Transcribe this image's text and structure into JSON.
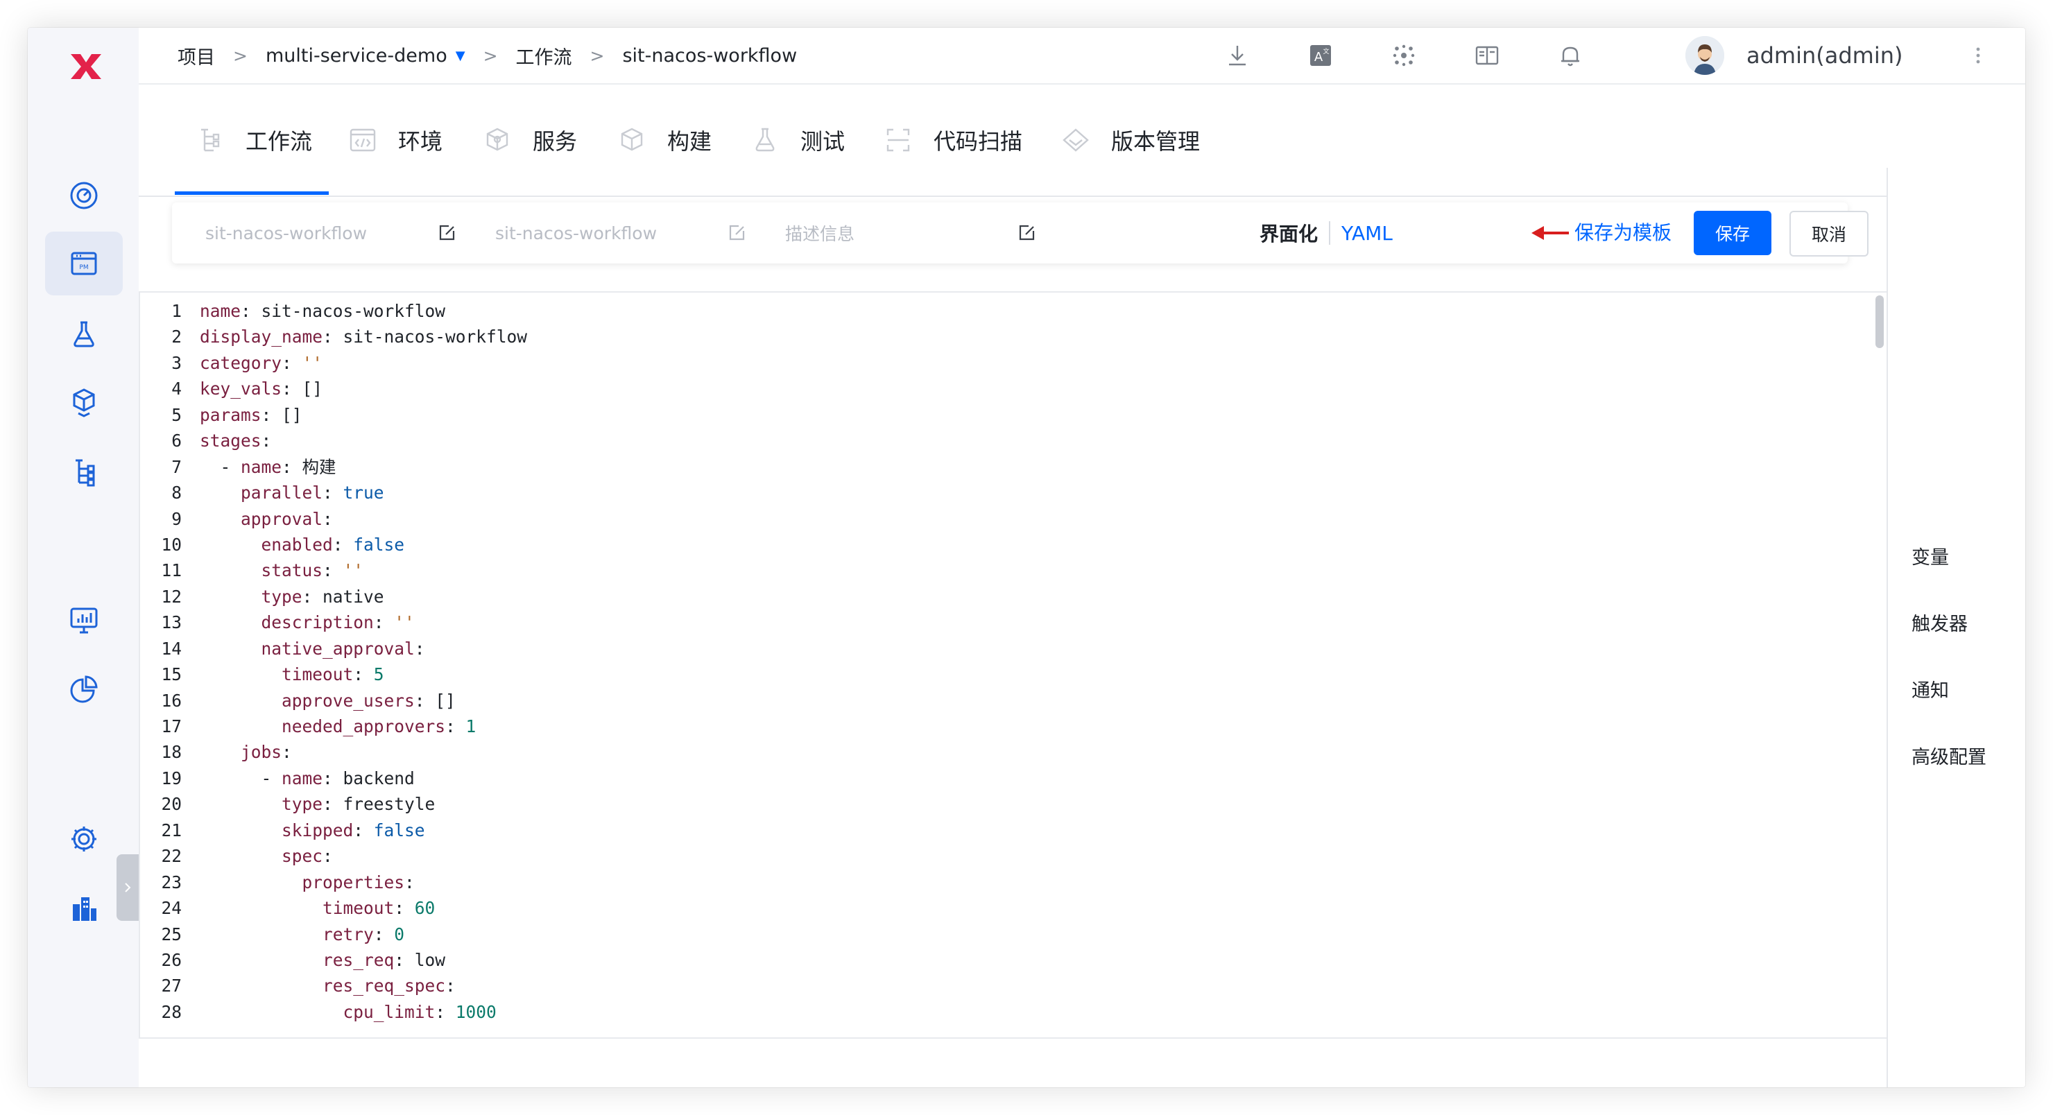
{
  "breadcrumb": {
    "project": "项目",
    "project_name": "multi-service-demo",
    "section": "工作流",
    "workflow": "sit-nacos-workflow",
    "separator": ">"
  },
  "user": {
    "name": "admin(admin)"
  },
  "top_icons": [
    "download-icon",
    "translate-icon",
    "plugin-icon",
    "docs-icon",
    "bell-icon"
  ],
  "tabs": [
    {
      "label": "工作流",
      "icon": "workflow-icon",
      "active": true
    },
    {
      "label": "环境",
      "icon": "environment-icon"
    },
    {
      "label": "服务",
      "icon": "service-icon"
    },
    {
      "label": "构建",
      "icon": "build-icon"
    },
    {
      "label": "测试",
      "icon": "test-icon"
    },
    {
      "label": "代码扫描",
      "icon": "code-scan-icon"
    },
    {
      "label": "版本管理",
      "icon": "version-icon"
    }
  ],
  "form": {
    "name_placeholder": "sit-nacos-workflow",
    "display_placeholder": "sit-nacos-workflow",
    "desc_placeholder": "描述信息",
    "mode_ui": "界面化",
    "mode_yaml": "YAML",
    "save_template": "保存为模板",
    "save": "保存",
    "cancel": "取消"
  },
  "right_panel": [
    "变量",
    "触发器",
    "通知",
    "高级配置"
  ],
  "colors": {
    "accent": "#0066ff",
    "brand": "#e3224a",
    "annotation_arrow": "#d81e1e"
  },
  "code": [
    {
      "n": "1",
      "i": "",
      "k": "name",
      "v": "sit-nacos-workflow",
      "t": "v"
    },
    {
      "n": "2",
      "i": "",
      "k": "display_name",
      "v": "sit-nacos-workflow",
      "t": "v"
    },
    {
      "n": "3",
      "i": "",
      "k": "category",
      "v": "''",
      "t": "str"
    },
    {
      "n": "4",
      "i": "",
      "k": "key_vals",
      "v": "[]",
      "t": "v"
    },
    {
      "n": "5",
      "i": "",
      "k": "params",
      "v": "[]",
      "t": "v"
    },
    {
      "n": "6",
      "i": "",
      "k": "stages",
      "v": "",
      "t": "v"
    },
    {
      "n": "7",
      "i": "  - ",
      "k": "name",
      "v": "构建",
      "t": "v"
    },
    {
      "n": "8",
      "i": "    ",
      "k": "parallel",
      "v": "true",
      "t": "bool"
    },
    {
      "n": "9",
      "i": "    ",
      "k": "approval",
      "v": "",
      "t": "v"
    },
    {
      "n": "10",
      "i": "      ",
      "k": "enabled",
      "v": "false",
      "t": "bool"
    },
    {
      "n": "11",
      "i": "      ",
      "k": "status",
      "v": "''",
      "t": "str"
    },
    {
      "n": "12",
      "i": "      ",
      "k": "type",
      "v": "native",
      "t": "v"
    },
    {
      "n": "13",
      "i": "      ",
      "k": "description",
      "v": "''",
      "t": "str"
    },
    {
      "n": "14",
      "i": "      ",
      "k": "native_approval",
      "v": "",
      "t": "v"
    },
    {
      "n": "15",
      "i": "        ",
      "k": "timeout",
      "v": "5",
      "t": "num"
    },
    {
      "n": "16",
      "i": "        ",
      "k": "approve_users",
      "v": "[]",
      "t": "v"
    },
    {
      "n": "17",
      "i": "        ",
      "k": "needed_approvers",
      "v": "1",
      "t": "num"
    },
    {
      "n": "18",
      "i": "    ",
      "k": "jobs",
      "v": "",
      "t": "v"
    },
    {
      "n": "19",
      "i": "      - ",
      "k": "name",
      "v": "backend",
      "t": "v"
    },
    {
      "n": "20",
      "i": "        ",
      "k": "type",
      "v": "freestyle",
      "t": "v"
    },
    {
      "n": "21",
      "i": "        ",
      "k": "skipped",
      "v": "false",
      "t": "bool"
    },
    {
      "n": "22",
      "i": "        ",
      "k": "spec",
      "v": "",
      "t": "v"
    },
    {
      "n": "23",
      "i": "          ",
      "k": "properties",
      "v": "",
      "t": "v"
    },
    {
      "n": "24",
      "i": "            ",
      "k": "timeout",
      "v": "60",
      "t": "num"
    },
    {
      "n": "25",
      "i": "            ",
      "k": "retry",
      "v": "0",
      "t": "num"
    },
    {
      "n": "26",
      "i": "            ",
      "k": "res_req",
      "v": "low",
      "t": "v"
    },
    {
      "n": "27",
      "i": "            ",
      "k": "res_req_spec",
      "v": "",
      "t": "v"
    },
    {
      "n": "28",
      "i": "              ",
      "k": "cpu_limit",
      "v": "1000",
      "t": "num"
    }
  ]
}
